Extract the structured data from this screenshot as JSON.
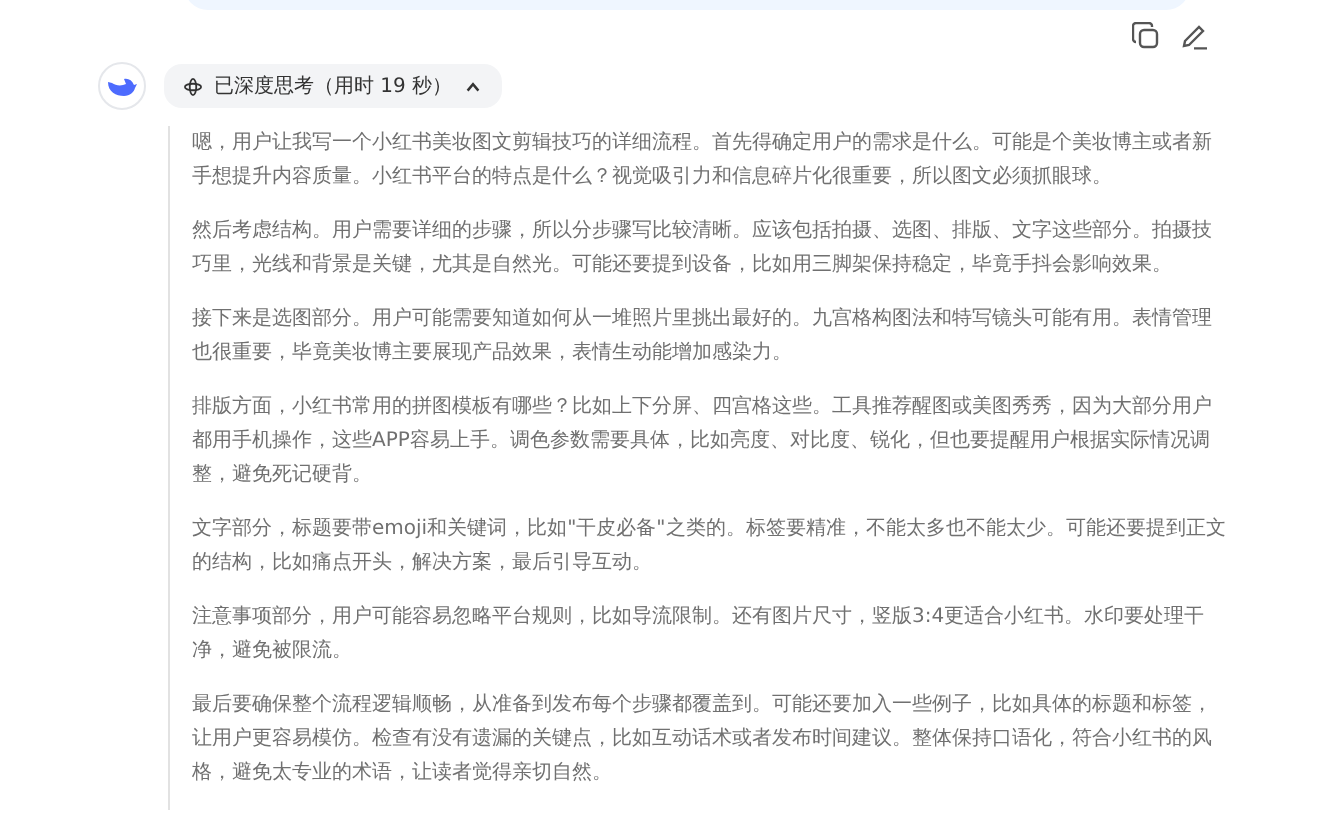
{
  "thinking": {
    "label": "已深度思考（用时 19 秒）",
    "expanded": true
  },
  "paragraphs": [
    "嗯，用户让我写一个小红书美妆图文剪辑技巧的详细流程。首先得确定用户的需求是什么。可能是个美妆博主或者新手想提升内容质量。小红书平台的特点是什么？视觉吸引力和信息碎片化很重要，所以图文必须抓眼球。",
    "然后考虑结构。用户需要详细的步骤，所以分步骤写比较清晰。应该包括拍摄、选图、排版、文字这些部分。拍摄技巧里，光线和背景是关键，尤其是自然光。可能还要提到设备，比如用三脚架保持稳定，毕竟手抖会影响效果。",
    "接下来是选图部分。用户可能需要知道如何从一堆照片里挑出最好的。九宫格构图法和特写镜头可能有用。表情管理也很重要，毕竟美妆博主要展现产品效果，表情生动能增加感染力。",
    "排版方面，小红书常用的拼图模板有哪些？比如上下分屏、四宫格这些。工具推荐醒图或美图秀秀，因为大部分用户都用手机操作，这些APP容易上手。调色参数需要具体，比如亮度、对比度、锐化，但也要提醒用户根据实际情况调整，避免死记硬背。",
    "文字部分，标题要带emoji和关键词，比如\"干皮必备\"之类的。标签要精准，不能太多也不能太少。可能还要提到正文的结构，比如痛点开头，解决方案，最后引导互动。",
    "注意事项部分，用户可能容易忽略平台规则，比如导流限制。还有图片尺寸，竖版3:4更适合小红书。水印要处理干净，避免被限流。",
    "最后要确保整个流程逻辑顺畅，从准备到发布每个步骤都覆盖到。可能还要加入一些例子，比如具体的标题和标签，让用户更容易模仿。检查有没有遗漏的关键点，比如互动话术或者发布时间建议。整体保持口语化，符合小红书的风格，避免太专业的术语，让读者觉得亲切自然。"
  ]
}
